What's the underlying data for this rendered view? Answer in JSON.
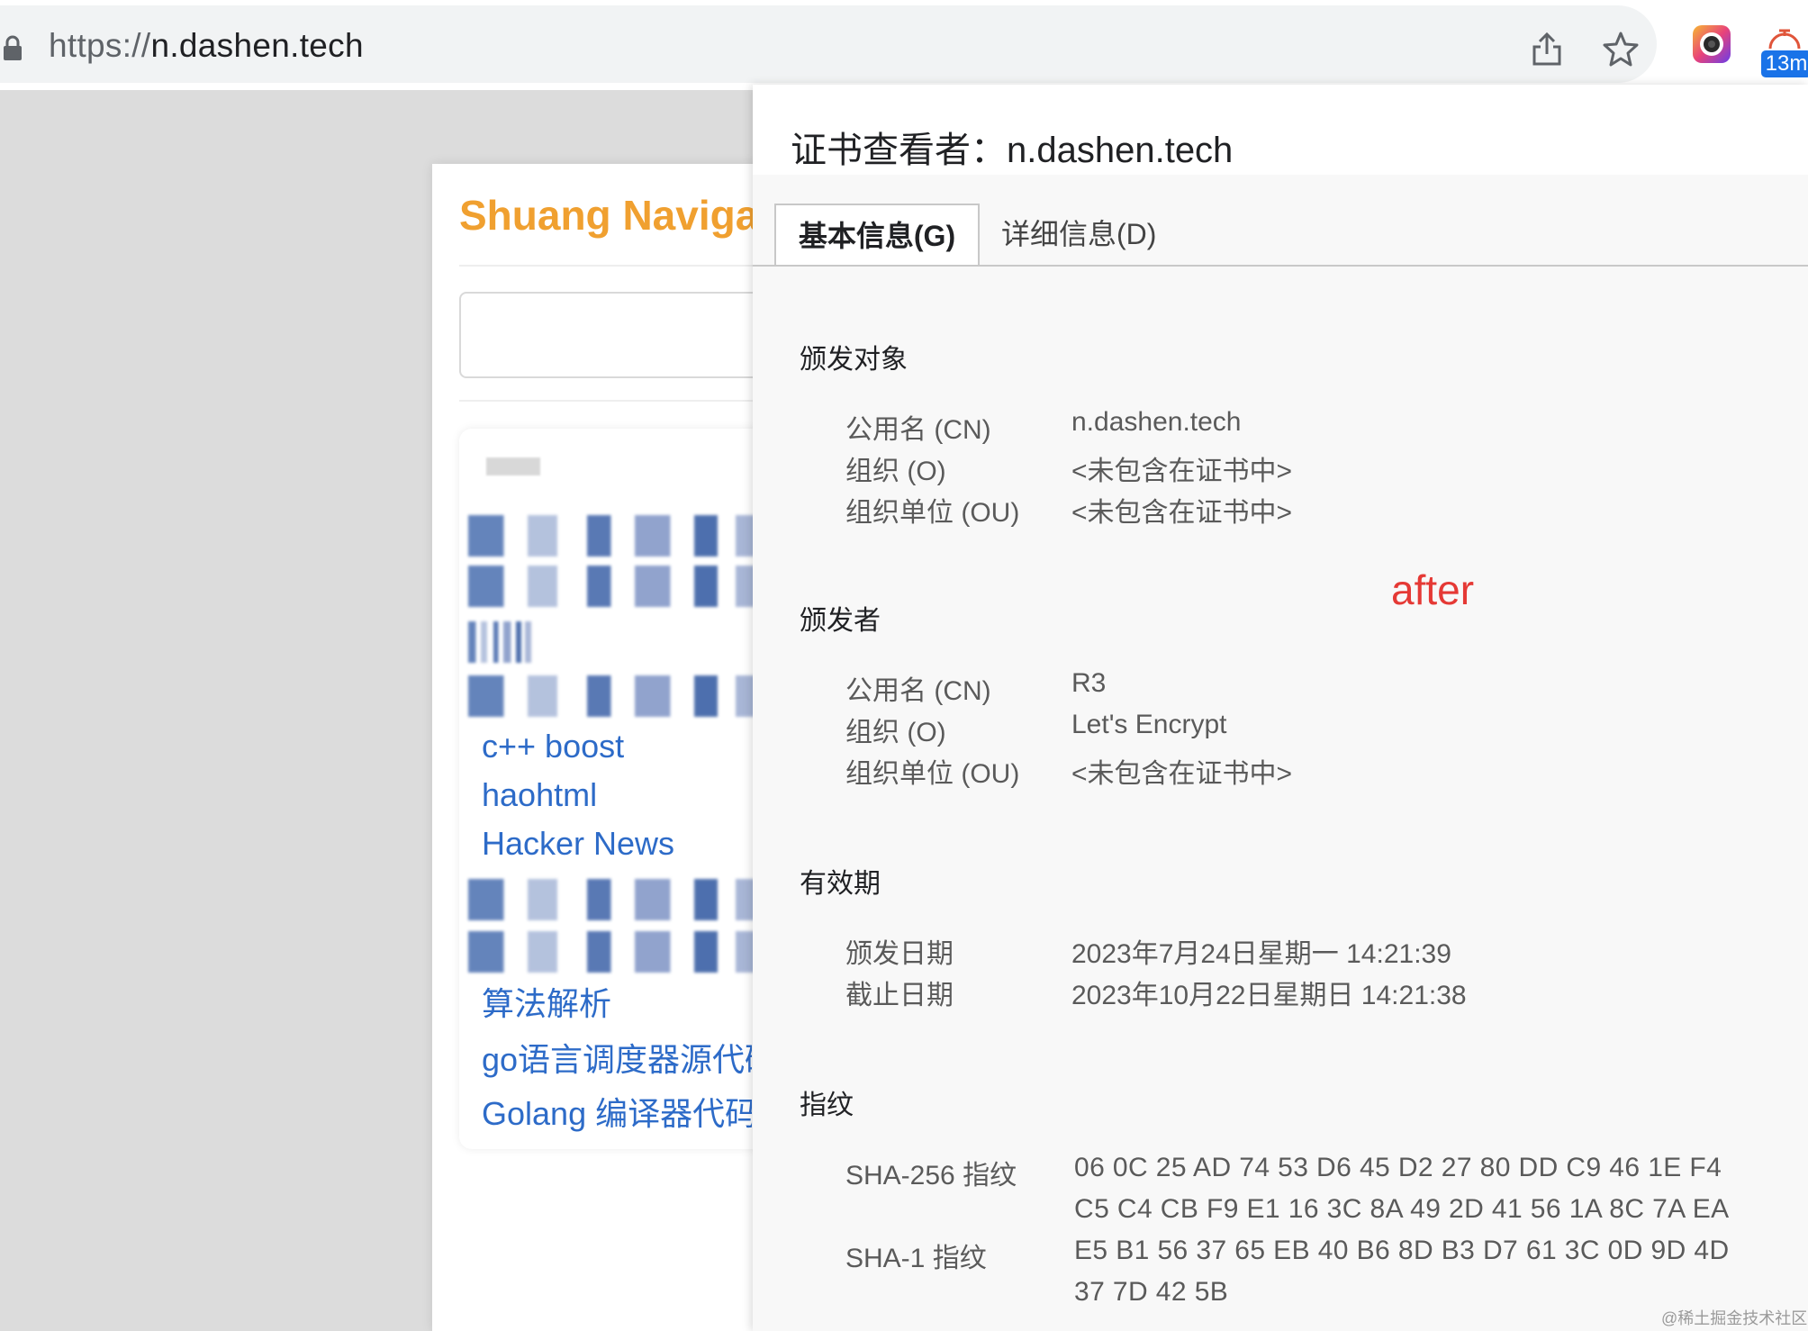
{
  "browser": {
    "url_scheme": "https://",
    "url_host": "n.dashen.tech",
    "timer_badge": "13m"
  },
  "page": {
    "site_title": "Shuang Naviga",
    "links": [
      "c++ boost",
      "haohtml",
      "Hacker News",
      "算法解析",
      "go语言调度器源代码",
      "Golang 编译器代码"
    ]
  },
  "cert_viewer": {
    "title": "证书查看者：n.dashen.tech",
    "tabs": {
      "basic": "基本信息(G)",
      "details": "详细信息(D)"
    },
    "issued_to": {
      "heading": "颁发对象",
      "rows": [
        {
          "label": "公用名 (CN)",
          "value": "n.dashen.tech"
        },
        {
          "label": "组织 (O)",
          "value": "<未包含在证书中>"
        },
        {
          "label": "组织单位 (OU)",
          "value": "<未包含在证书中>"
        }
      ]
    },
    "issued_by": {
      "heading": "颁发者",
      "rows": [
        {
          "label": "公用名 (CN)",
          "value": "R3"
        },
        {
          "label": "组织 (O)",
          "value": "Let's Encrypt"
        },
        {
          "label": "组织单位 (OU)",
          "value": "<未包含在证书中>"
        }
      ]
    },
    "validity": {
      "heading": "有效期",
      "rows": [
        {
          "label": "颁发日期",
          "value": "2023年7月24日星期一 14:21:39"
        },
        {
          "label": "截止日期",
          "value": "2023年10月22日星期日 14:21:38"
        }
      ]
    },
    "fingerprints": {
      "heading": "指纹",
      "sha256_label": "SHA-256 指纹",
      "sha256_lines": [
        "06 0C 25 AD 74 53 D6 45 D2 27 80 DD C9 46 1E F4",
        "C5 C4 CB F9 E1 16 3C 8A 49 2D 41 56 1A 8C 7A EA"
      ],
      "sha1_label": "SHA-1 指纹",
      "sha1_lines": [
        "E5 B1 56 37 65 EB 40 B6 8D B3 D7 61 3C 0D 9D 4D",
        "37 7D 42 5B"
      ]
    }
  },
  "annotation": {
    "after": "after"
  },
  "watermark": "@稀土掘金技术社区"
}
